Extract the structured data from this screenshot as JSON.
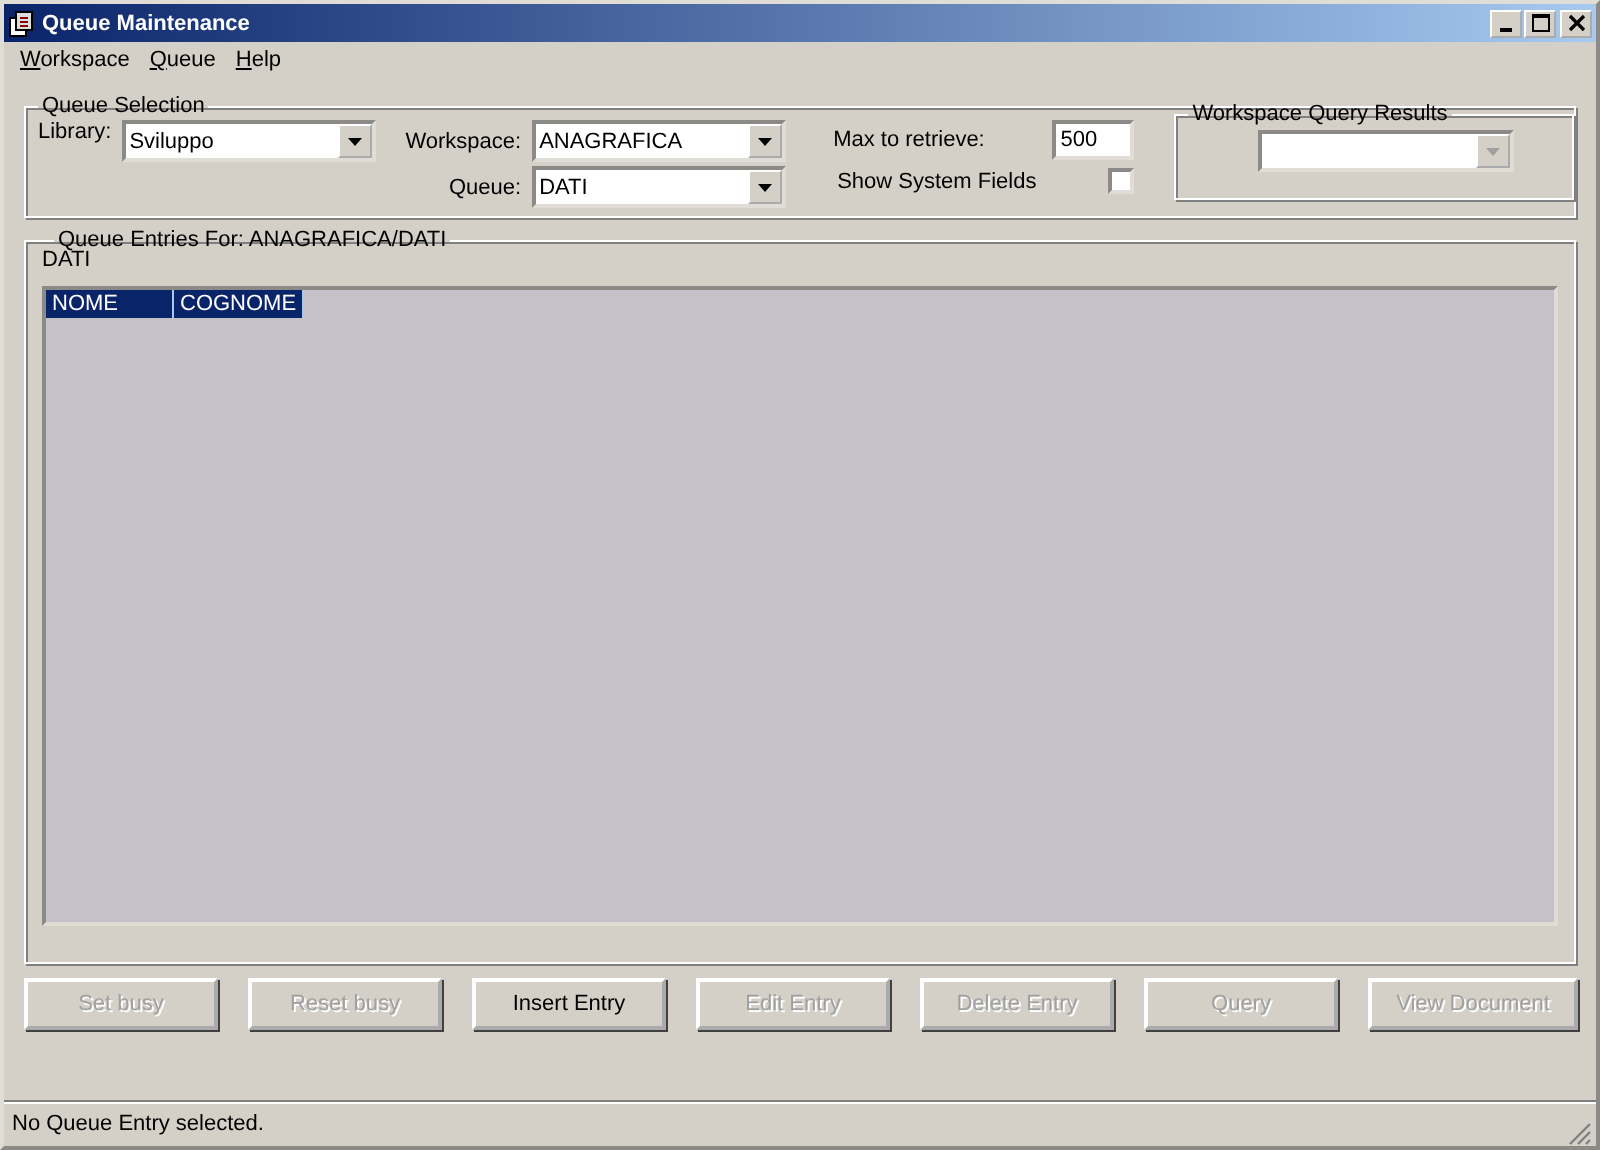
{
  "window": {
    "title": "Queue Maintenance"
  },
  "menu": [
    "Workspace",
    "Queue",
    "Help"
  ],
  "queue_selection": {
    "title": "Queue Selection",
    "library": {
      "label": "Library:",
      "value": "Sviluppo"
    },
    "workspace": {
      "label": "Workspace:",
      "value": "ANAGRAFICA"
    },
    "queue": {
      "label": "Queue:",
      "value": "DATI"
    },
    "max_to_retrieve": {
      "label": "Max to retrieve:",
      "value": "500"
    },
    "show_system_fields": {
      "label": "Show System Fields",
      "checked": false
    },
    "workspace_query_results": {
      "title": "Workspace Query Results",
      "disabled": true
    }
  },
  "entries": {
    "title": "Queue Entries For: ANAGRAFICA/DATI",
    "caption": "DATI",
    "columns": [
      "NOME",
      "COGNOME"
    ]
  },
  "buttons": [
    {
      "label": "Set busy",
      "disabled": true
    },
    {
      "label": "Reset busy",
      "disabled": true
    },
    {
      "label": "Insert Entry",
      "disabled": false
    },
    {
      "label": "Edit Entry",
      "disabled": true
    },
    {
      "label": "Delete Entry",
      "disabled": true
    },
    {
      "label": "Query",
      "disabled": true
    },
    {
      "label": "View Document",
      "disabled": true
    }
  ],
  "status_bar": "No Queue Entry selected."
}
